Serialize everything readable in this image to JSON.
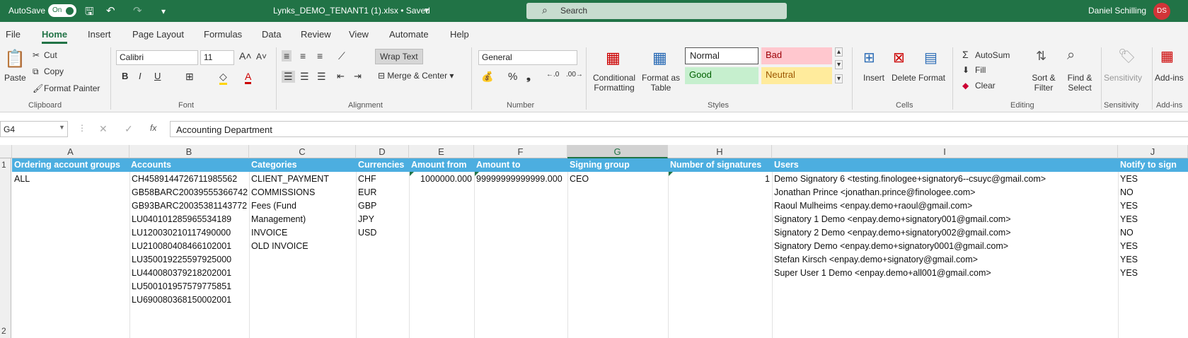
{
  "titlebar": {
    "autosave_label": "AutoSave",
    "autosave_state": "On",
    "filename": "Lynks_DEMO_TENANT1 (1).xlsx • Saved",
    "search_placeholder": "Search",
    "user_name": "Daniel Schilling",
    "user_initials": "DS"
  },
  "menu": [
    "File",
    "Home",
    "Insert",
    "Page Layout",
    "Formulas",
    "Data",
    "Review",
    "View",
    "Automate",
    "Help"
  ],
  "ribbon": {
    "clipboard": {
      "paste": "Paste",
      "cut": "Cut",
      "copy": "Copy",
      "format_painter": "Format Painter",
      "group": "Clipboard"
    },
    "font": {
      "name": "Calibri",
      "size": "11",
      "group": "Font"
    },
    "alignment": {
      "wrap_text": "Wrap Text",
      "merge_center": "Merge & Center",
      "group": "Alignment"
    },
    "number": {
      "format": "General",
      "group": "Number"
    },
    "styles": {
      "conditional": "Conditional Formatting",
      "format_table": "Format as Table",
      "normal": "Normal",
      "bad": "Bad",
      "good": "Good",
      "neutral": "Neutral",
      "group": "Styles"
    },
    "cells": {
      "insert": "Insert",
      "delete": "Delete",
      "format": "Format",
      "group": "Cells"
    },
    "editing": {
      "autosum": "AutoSum",
      "fill": "Fill",
      "clear": "Clear",
      "sort_filter": "Sort & Filter",
      "find_select": "Find & Select",
      "group": "Editing"
    },
    "sensitivity": {
      "label": "Sensitivity",
      "group": "Sensitivity"
    },
    "addins": {
      "label": "Add-ins",
      "group": "Add-ins"
    }
  },
  "formula_bar": {
    "name_box": "G4",
    "content": "Accounting Department"
  },
  "columns": [
    "A",
    "B",
    "C",
    "D",
    "E",
    "F",
    "G",
    "H",
    "I",
    "J"
  ],
  "rows": [
    "1",
    "2"
  ],
  "headers": [
    "Ordering account groups",
    "Accounts",
    "Categories",
    "Currencies",
    "Amount from",
    "Amount to",
    "Signing group",
    "Number of signatures",
    "Users",
    "Notify to sign"
  ],
  "data": {
    "group": "ALL",
    "accounts": [
      "CH4589144726711985562",
      "GB58BARC20039555366742",
      "GB93BARC20035381143772",
      "LU040101285965534189",
      "LU120030210117490000",
      "LU210080408466102001",
      "LU350019225597925000",
      "LU440080379218202001",
      "LU500101957579775851",
      "LU690080368150002001"
    ],
    "categories": [
      "CLIENT_PAYMENT",
      "COMMISSIONS",
      "Fees (Fund",
      "Management)",
      "INVOICE",
      "OLD INVOICE"
    ],
    "currencies": [
      "CHF",
      "EUR",
      "GBP",
      "JPY",
      "USD"
    ],
    "amount_from": "1000000.000",
    "amount_to": "99999999999999.000",
    "signing_group": "CEO",
    "num_signatures": "1",
    "users": [
      "Demo Signatory 6 <testing.finologee+signatory6--csuyc@gmail.com>",
      "Jonathan Prince <jonathan.prince@finologee.com>",
      "Raoul Mulheims <enpay.demo+raoul@gmail.com>",
      "Signatory 1 Demo <enpay.demo+signatory001@gmail.com>",
      "Signatory 2 Demo <enpay.demo+signatory002@gmail.com>",
      "Signatory Demo <enpay.demo+signatory0001@gmail.com>",
      "Stefan Kirsch <enpay.demo+signatory@gmail.com>",
      "Super User 1 Demo <enpay.demo+all001@gmail.com>"
    ],
    "notify": [
      "YES",
      "NO",
      "YES",
      "YES",
      "NO",
      "YES",
      "YES",
      "YES"
    ]
  }
}
